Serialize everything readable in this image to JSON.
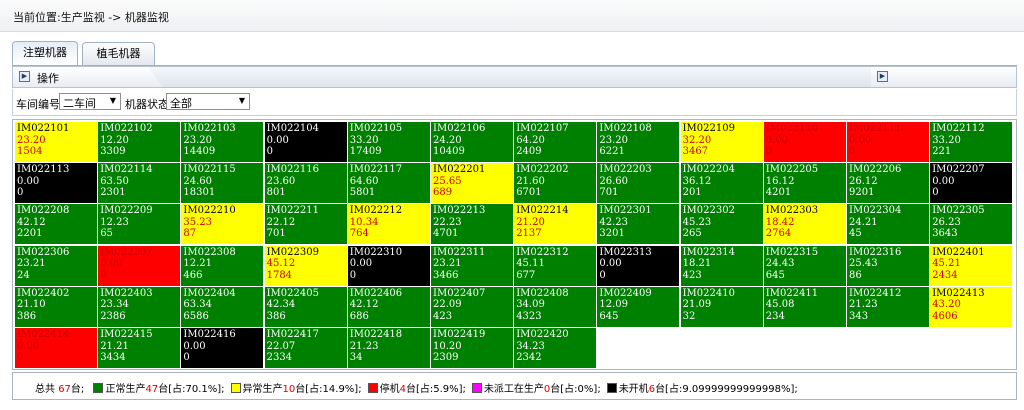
{
  "breadcrumb": {
    "prefix": "当前位置:",
    "path": "生产监视 -> 机器监视"
  },
  "tabs": [
    {
      "label": "注塑机器"
    },
    {
      "label": "植毛机器"
    }
  ],
  "operation": {
    "label": "操作"
  },
  "filters": {
    "workshop_label": "车间编号:",
    "workshop_value": "二车间",
    "status_label": "机器状态:",
    "status_value": "全部"
  },
  "colors": {
    "normal": "#008000",
    "abnormal": "#ffff00",
    "stopped": "#ff0000",
    "unassigned": "#ff00ff",
    "off": "#000000"
  },
  "machines": [
    {
      "id": "IM022101",
      "a": "23.20",
      "b": "1504",
      "status": "abnormal"
    },
    {
      "id": "IM022102",
      "a": "12.20",
      "b": "3309",
      "status": "normal"
    },
    {
      "id": "IM022103",
      "a": "23.20",
      "b": "14409",
      "status": "normal"
    },
    {
      "id": "IM022104",
      "a": "0.00",
      "b": "0",
      "status": "off"
    },
    {
      "id": "IM022105",
      "a": "33.20",
      "b": "17409",
      "status": "normal"
    },
    {
      "id": "IM022106",
      "a": "24.20",
      "b": "10409",
      "status": "normal"
    },
    {
      "id": "IM022107",
      "a": "64.20",
      "b": "2409",
      "status": "normal"
    },
    {
      "id": "IM022108",
      "a": "23.20",
      "b": "6221",
      "status": "normal"
    },
    {
      "id": "IM022109",
      "a": "32.20",
      "b": "3467",
      "status": "abnormal"
    },
    {
      "id": "IM022110",
      "a": "0.00",
      "b": "0",
      "status": "stopped"
    },
    {
      "id": "IM022111",
      "a": "0.00",
      "b": "0",
      "status": "stopped"
    },
    {
      "id": "IM022112",
      "a": "33.20",
      "b": "221",
      "status": "normal"
    },
    {
      "id": "IM022113",
      "a": "0.00",
      "b": "0",
      "status": "off"
    },
    {
      "id": "IM022114",
      "a": "63.50",
      "b": "2301",
      "status": "normal"
    },
    {
      "id": "IM022115",
      "a": "24.60",
      "b": "18301",
      "status": "normal"
    },
    {
      "id": "IM022116",
      "a": "23.60",
      "b": "801",
      "status": "normal"
    },
    {
      "id": "IM022117",
      "a": "64.60",
      "b": "5801",
      "status": "normal"
    },
    {
      "id": "IM022201",
      "a": "25.65",
      "b": "689",
      "status": "abnormal"
    },
    {
      "id": "IM022202",
      "a": "21.60",
      "b": "6701",
      "status": "normal"
    },
    {
      "id": "IM022203",
      "a": "26.60",
      "b": "701",
      "status": "normal"
    },
    {
      "id": "IM022204",
      "a": "36.12",
      "b": "201",
      "status": "normal"
    },
    {
      "id": "IM022205",
      "a": "16.12",
      "b": "4201",
      "status": "normal"
    },
    {
      "id": "IM022206",
      "a": "26.12",
      "b": "9201",
      "status": "normal"
    },
    {
      "id": "IM022207",
      "a": "0.00",
      "b": "0",
      "status": "off"
    },
    {
      "id": "IM022208",
      "a": "42.12",
      "b": "2201",
      "status": "normal"
    },
    {
      "id": "IM022209",
      "a": "12.23",
      "b": "65",
      "status": "normal"
    },
    {
      "id": "IM022210",
      "a": "35.23",
      "b": "87",
      "status": "abnormal"
    },
    {
      "id": "IM022211",
      "a": "22.12",
      "b": "701",
      "status": "normal"
    },
    {
      "id": "IM022212",
      "a": "10.34",
      "b": "764",
      "status": "abnormal"
    },
    {
      "id": "IM022213",
      "a": "22.23",
      "b": "4701",
      "status": "normal"
    },
    {
      "id": "IM022214",
      "a": "21.20",
      "b": "2137",
      "status": "abnormal"
    },
    {
      "id": "IM022301",
      "a": "42.23",
      "b": "3201",
      "status": "normal"
    },
    {
      "id": "IM022302",
      "a": "45.23",
      "b": "265",
      "status": "normal"
    },
    {
      "id": "IM022303",
      "a": "18.42",
      "b": "2764",
      "status": "abnormal"
    },
    {
      "id": "IM022304",
      "a": "24.21",
      "b": "45",
      "status": "normal"
    },
    {
      "id": "IM022305",
      "a": "26.23",
      "b": "3643",
      "status": "normal"
    },
    {
      "id": "IM022306",
      "a": "23.21",
      "b": "24",
      "status": "normal"
    },
    {
      "id": "IM022307",
      "a": "0.00",
      "b": "0",
      "status": "stopped"
    },
    {
      "id": "IM022308",
      "a": "12.21",
      "b": "466",
      "status": "normal"
    },
    {
      "id": "IM022309",
      "a": "45.12",
      "b": "1784",
      "status": "abnormal"
    },
    {
      "id": "IM022310",
      "a": "0.00",
      "b": "0",
      "status": "off"
    },
    {
      "id": "IM022311",
      "a": "23.21",
      "b": "3466",
      "status": "normal"
    },
    {
      "id": "IM022312",
      "a": "45.11",
      "b": "677",
      "status": "normal"
    },
    {
      "id": "IM022313",
      "a": "0.00",
      "b": "0",
      "status": "off"
    },
    {
      "id": "IM022314",
      "a": "18.21",
      "b": "423",
      "status": "normal"
    },
    {
      "id": "IM022315",
      "a": "24.43",
      "b": "645",
      "status": "normal"
    },
    {
      "id": "IM022316",
      "a": "25.43",
      "b": "86",
      "status": "normal"
    },
    {
      "id": "IM022401",
      "a": "45.21",
      "b": "2434",
      "status": "abnormal"
    },
    {
      "id": "IM022402",
      "a": "21.10",
      "b": "386",
      "status": "normal"
    },
    {
      "id": "IM022403",
      "a": "23.34",
      "b": "2386",
      "status": "normal"
    },
    {
      "id": "IM022404",
      "a": "63.34",
      "b": "6586",
      "status": "normal"
    },
    {
      "id": "IM022405",
      "a": "42.34",
      "b": "386",
      "status": "normal"
    },
    {
      "id": "IM022406",
      "a": "42.12",
      "b": "686",
      "status": "normal"
    },
    {
      "id": "IM022407",
      "a": "22.09",
      "b": "423",
      "status": "normal"
    },
    {
      "id": "IM022408",
      "a": "34.09",
      "b": "4323",
      "status": "normal"
    },
    {
      "id": "IM022409",
      "a": "12.09",
      "b": "645",
      "status": "normal"
    },
    {
      "id": "IM022410",
      "a": "21.09",
      "b": "32",
      "status": "normal"
    },
    {
      "id": "IM022411",
      "a": "45.08",
      "b": "234",
      "status": "normal"
    },
    {
      "id": "IM022412",
      "a": "21.23",
      "b": "343",
      "status": "normal"
    },
    {
      "id": "IM022413",
      "a": "43.20",
      "b": "4606",
      "status": "abnormal"
    },
    {
      "id": "IM022414",
      "a": "0.00",
      "b": "0",
      "status": "stopped"
    },
    {
      "id": "IM022415",
      "a": "21.21",
      "b": "3434",
      "status": "normal"
    },
    {
      "id": "IM022416",
      "a": "0.00",
      "b": "0",
      "status": "off"
    },
    {
      "id": "IM022417",
      "a": "22.07",
      "b": "2334",
      "status": "normal"
    },
    {
      "id": "IM022418",
      "a": "21.23",
      "b": "34",
      "status": "normal"
    },
    {
      "id": "IM022419",
      "a": "10.20",
      "b": "2309",
      "status": "normal"
    },
    {
      "id": "IM022420",
      "a": "34.23",
      "b": "2342",
      "status": "normal"
    }
  ],
  "legend": {
    "total_label": "总共",
    "total_count": "67",
    "unit": "台;",
    "items": [
      {
        "status": "normal",
        "label": "正常生产",
        "count": "47",
        "suffix": "台[占:70.1%];"
      },
      {
        "status": "abnormal",
        "label": "异常生产",
        "count": "10",
        "suffix": "台[占:14.9%];"
      },
      {
        "status": "stopped",
        "label": "停机",
        "count": "4",
        "suffix": "台[占:5.9%];"
      },
      {
        "status": "unassigned",
        "label": "未派工在生产",
        "count": "0",
        "suffix": "台[占:0%];"
      },
      {
        "status": "off",
        "label": "未开机",
        "count": "6",
        "suffix": "台[占:9.09999999999998%];"
      }
    ]
  }
}
